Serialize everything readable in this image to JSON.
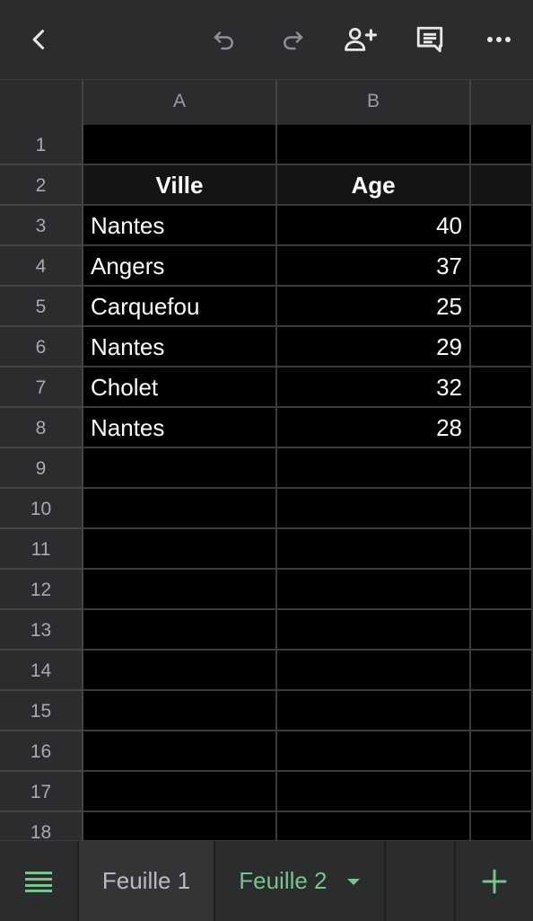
{
  "toolbar": {
    "icons": [
      "back-icon",
      "undo-icon",
      "redo-icon",
      "add-person-icon",
      "comment-icon",
      "more-icon"
    ]
  },
  "columns": [
    "A",
    "B"
  ],
  "rows": [
    {
      "num": "1",
      "a": "",
      "b": ""
    },
    {
      "num": "2",
      "a": "Ville",
      "b": "Age"
    },
    {
      "num": "3",
      "a": "Nantes",
      "b": "40"
    },
    {
      "num": "4",
      "a": "Angers",
      "b": "37"
    },
    {
      "num": "5",
      "a": "Carquefou",
      "b": "25"
    },
    {
      "num": "6",
      "a": "Nantes",
      "b": "29"
    },
    {
      "num": "7",
      "a": "Cholet",
      "b": "32"
    },
    {
      "num": "8",
      "a": "Nantes",
      "b": "28"
    },
    {
      "num": "9",
      "a": "",
      "b": ""
    },
    {
      "num": "10",
      "a": "",
      "b": ""
    },
    {
      "num": "11",
      "a": "",
      "b": ""
    },
    {
      "num": "12",
      "a": "",
      "b": ""
    },
    {
      "num": "13",
      "a": "",
      "b": ""
    },
    {
      "num": "14",
      "a": "",
      "b": ""
    },
    {
      "num": "15",
      "a": "",
      "b": ""
    },
    {
      "num": "16",
      "a": "",
      "b": ""
    },
    {
      "num": "17",
      "a": "",
      "b": ""
    },
    {
      "num": "18",
      "a": "",
      "b": ""
    }
  ],
  "tabs": {
    "sheet1": "Feuille 1",
    "sheet2": "Feuille 2",
    "active_color": "#77c48c"
  }
}
